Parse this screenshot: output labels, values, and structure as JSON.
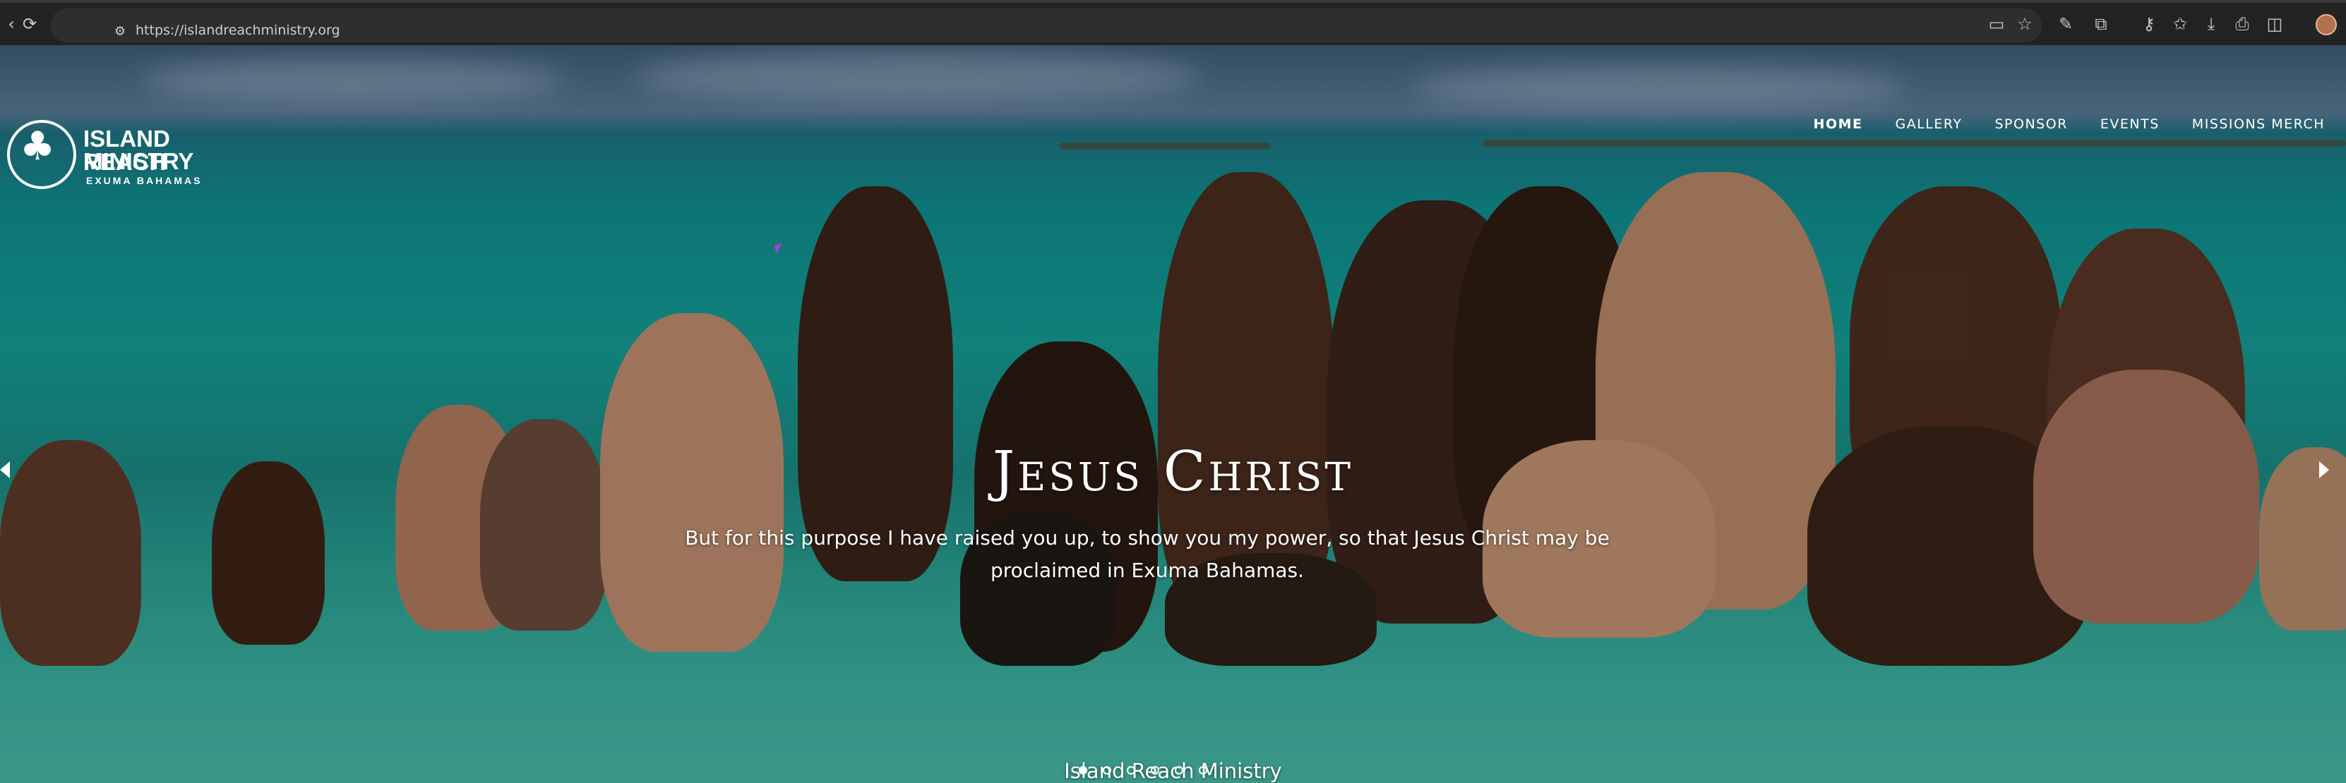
{
  "browser": {
    "url": "https://islandreachministry.org",
    "icons": [
      "back-icon",
      "reload-icon",
      "site-info-icon",
      "install-app-icon",
      "bookmark-star-icon",
      "extension-icon",
      "puzzle-icon",
      "password-key-icon",
      "favorites-icon",
      "download-icon",
      "print-icon",
      "split-screen-icon",
      "profile-avatar"
    ]
  },
  "logo": {
    "line1": "ISLAND REACH",
    "line2": "MINISTRY",
    "tagline": "EXUMA BAHAMAS"
  },
  "nav": {
    "items": [
      {
        "label": "HOME",
        "active": true
      },
      {
        "label": "GALLERY",
        "active": false
      },
      {
        "label": "SPONSOR",
        "active": false
      },
      {
        "label": "EVENTS",
        "active": false
      },
      {
        "label": "MISSIONS MERCH",
        "active": false
      }
    ]
  },
  "slider": {
    "title": "Jesus Christ",
    "description": "But for this purpose I have raised you up, to show you my power, so that Jesus Christ may be proclaimed in Exuma Bahamas.",
    "caption": "Island Reach Ministry",
    "dot_count": 6,
    "active_dot": 0
  },
  "colors": {
    "toolbar": "#232324",
    "water": "#159d96",
    "text": "#ffffff"
  }
}
